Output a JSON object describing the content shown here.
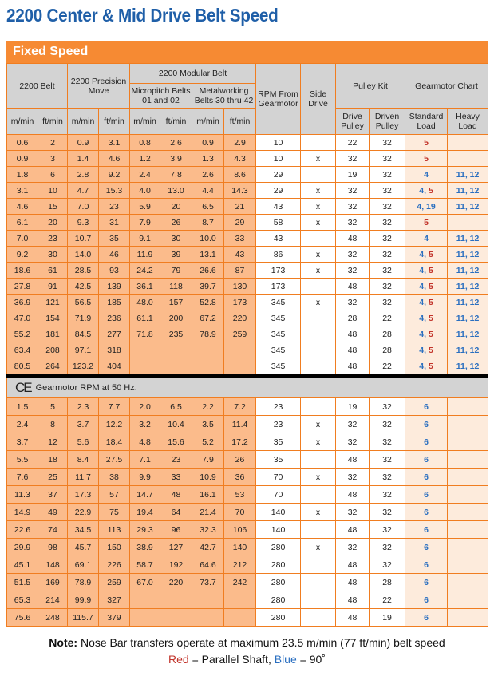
{
  "title": "2200 Center & Mid Drive Belt Speed",
  "section_label": "Fixed Speed",
  "headers": {
    "belt_2200": "2200 Belt",
    "precision_move": "2200 Precision Move",
    "modular_belt": "2200 Modular Belt",
    "micropitch": "Micropitch Belts 01 and 02",
    "metalworking": "Metalworking Belts 30 thru 42",
    "rpm": "RPM From Gearmotor",
    "side_drive": "Side Drive",
    "pulley_kit": "Pulley Kit",
    "gearmotor_chart": "Gearmotor Chart",
    "m_min": "m/min",
    "ft_min": "ft/min",
    "drive_pulley": "Drive Pulley",
    "driven_pulley": "Driven Pulley",
    "standard_load": "Standard Load",
    "heavy_load": "Heavy Load"
  },
  "colors": {
    "red": "#c2342b",
    "blue": "#2a6fc0",
    "accent": "#f68a33"
  },
  "rows_60hz": [
    {
      "v": [
        "0.6",
        "2",
        "0.9",
        "3.1",
        "0.8",
        "2.6",
        "0.9",
        "2.9"
      ],
      "rpm": "10",
      "side": "",
      "drive": "22",
      "driven": "32",
      "std": [
        {
          "t": "5",
          "c": "red"
        }
      ],
      "heavy": ""
    },
    {
      "v": [
        "0.9",
        "3",
        "1.4",
        "4.6",
        "1.2",
        "3.9",
        "1.3",
        "4.3"
      ],
      "rpm": "10",
      "side": "x",
      "drive": "32",
      "driven": "32",
      "std": [
        {
          "t": "5",
          "c": "red"
        }
      ],
      "heavy": ""
    },
    {
      "v": [
        "1.8",
        "6",
        "2.8",
        "9.2",
        "2.4",
        "7.8",
        "2.6",
        "8.6"
      ],
      "rpm": "29",
      "side": "",
      "drive": "19",
      "driven": "32",
      "std": [
        {
          "t": "4",
          "c": "blue"
        }
      ],
      "heavy": "11, 12"
    },
    {
      "v": [
        "3.1",
        "10",
        "4.7",
        "15.3",
        "4.0",
        "13.0",
        "4.4",
        "14.3"
      ],
      "rpm": "29",
      "side": "x",
      "drive": "32",
      "driven": "32",
      "std": [
        {
          "t": "4",
          "c": "blue"
        },
        {
          "t": "5",
          "c": "red"
        }
      ],
      "heavy": "11, 12"
    },
    {
      "v": [
        "4.6",
        "15",
        "7.0",
        "23",
        "5.9",
        "20",
        "6.5",
        "21"
      ],
      "rpm": "43",
      "side": "x",
      "drive": "32",
      "driven": "32",
      "std": [
        {
          "t": "4",
          "c": "blue"
        },
        {
          "t": "19",
          "c": "blue"
        }
      ],
      "heavy": "11, 12"
    },
    {
      "v": [
        "6.1",
        "20",
        "9.3",
        "31",
        "7.9",
        "26",
        "8.7",
        "29"
      ],
      "rpm": "58",
      "side": "x",
      "drive": "32",
      "driven": "32",
      "std": [
        {
          "t": "5",
          "c": "red"
        }
      ],
      "heavy": ""
    },
    {
      "v": [
        "7.0",
        "23",
        "10.7",
        "35",
        "9.1",
        "30",
        "10.0",
        "33"
      ],
      "rpm": "43",
      "side": "",
      "drive": "48",
      "driven": "32",
      "std": [
        {
          "t": "4",
          "c": "blue"
        }
      ],
      "heavy": "11, 12"
    },
    {
      "v": [
        "9.2",
        "30",
        "14.0",
        "46",
        "11.9",
        "39",
        "13.1",
        "43"
      ],
      "rpm": "86",
      "side": "x",
      "drive": "32",
      "driven": "32",
      "std": [
        {
          "t": "4",
          "c": "blue"
        },
        {
          "t": "5",
          "c": "red"
        }
      ],
      "heavy": "11, 12"
    },
    {
      "v": [
        "18.6",
        "61",
        "28.5",
        "93",
        "24.2",
        "79",
        "26.6",
        "87"
      ],
      "rpm": "173",
      "side": "x",
      "drive": "32",
      "driven": "32",
      "std": [
        {
          "t": "4",
          "c": "blue"
        },
        {
          "t": "5",
          "c": "red"
        }
      ],
      "heavy": "11, 12"
    },
    {
      "v": [
        "27.8",
        "91",
        "42.5",
        "139",
        "36.1",
        "118",
        "39.7",
        "130"
      ],
      "rpm": "173",
      "side": "",
      "drive": "48",
      "driven": "32",
      "std": [
        {
          "t": "4",
          "c": "blue"
        },
        {
          "t": "5",
          "c": "red"
        }
      ],
      "heavy": "11, 12"
    },
    {
      "v": [
        "36.9",
        "121",
        "56.5",
        "185",
        "48.0",
        "157",
        "52.8",
        "173"
      ],
      "rpm": "345",
      "side": "x",
      "drive": "32",
      "driven": "32",
      "std": [
        {
          "t": "4",
          "c": "blue"
        },
        {
          "t": "5",
          "c": "red"
        }
      ],
      "heavy": "11, 12"
    },
    {
      "v": [
        "47.0",
        "154",
        "71.9",
        "236",
        "61.1",
        "200",
        "67.2",
        "220"
      ],
      "rpm": "345",
      "side": "",
      "drive": "28",
      "driven": "22",
      "std": [
        {
          "t": "4",
          "c": "blue"
        },
        {
          "t": "5",
          "c": "red"
        }
      ],
      "heavy": "11, 12"
    },
    {
      "v": [
        "55.2",
        "181",
        "84.5",
        "277",
        "71.8",
        "235",
        "78.9",
        "259"
      ],
      "rpm": "345",
      "side": "",
      "drive": "48",
      "driven": "28",
      "std": [
        {
          "t": "4",
          "c": "blue"
        },
        {
          "t": "5",
          "c": "red"
        }
      ],
      "heavy": "11, 12"
    },
    {
      "v": [
        "63.4",
        "208",
        "97.1",
        "318",
        "",
        "",
        "",
        ""
      ],
      "rpm": "345",
      "side": "",
      "drive": "48",
      "driven": "28",
      "std": [
        {
          "t": "4",
          "c": "blue"
        },
        {
          "t": "5",
          "c": "red"
        }
      ],
      "heavy": "11, 12"
    },
    {
      "v": [
        "80.5",
        "264",
        "123.2",
        "404",
        "",
        "",
        "",
        ""
      ],
      "rpm": "345",
      "side": "",
      "drive": "48",
      "driven": "22",
      "std": [
        {
          "t": "4",
          "c": "blue"
        },
        {
          "t": "5",
          "c": "red"
        }
      ],
      "heavy": "11, 12"
    }
  ],
  "ce_section": {
    "mark": "CE",
    "label": "Gearmotor RPM at 50 Hz."
  },
  "rows_50hz": [
    {
      "v": [
        "1.5",
        "5",
        "2.3",
        "7.7",
        "2.0",
        "6.5",
        "2.2",
        "7.2"
      ],
      "rpm": "23",
      "side": "",
      "drive": "19",
      "driven": "32",
      "std": [
        {
          "t": "6",
          "c": "blue"
        }
      ],
      "heavy": ""
    },
    {
      "v": [
        "2.4",
        "8",
        "3.7",
        "12.2",
        "3.2",
        "10.4",
        "3.5",
        "11.4"
      ],
      "rpm": "23",
      "side": "x",
      "drive": "32",
      "driven": "32",
      "std": [
        {
          "t": "6",
          "c": "blue"
        }
      ],
      "heavy": ""
    },
    {
      "v": [
        "3.7",
        "12",
        "5.6",
        "18.4",
        "4.8",
        "15.6",
        "5.2",
        "17.2"
      ],
      "rpm": "35",
      "side": "x",
      "drive": "32",
      "driven": "32",
      "std": [
        {
          "t": "6",
          "c": "blue"
        }
      ],
      "heavy": ""
    },
    {
      "v": [
        "5.5",
        "18",
        "8.4",
        "27.5",
        "7.1",
        "23",
        "7.9",
        "26"
      ],
      "rpm": "35",
      "side": "",
      "drive": "48",
      "driven": "32",
      "std": [
        {
          "t": "6",
          "c": "blue"
        }
      ],
      "heavy": ""
    },
    {
      "v": [
        "7.6",
        "25",
        "11.7",
        "38",
        "9.9",
        "33",
        "10.9",
        "36"
      ],
      "rpm": "70",
      "side": "x",
      "drive": "32",
      "driven": "32",
      "std": [
        {
          "t": "6",
          "c": "blue"
        }
      ],
      "heavy": ""
    },
    {
      "v": [
        "11.3",
        "37",
        "17.3",
        "57",
        "14.7",
        "48",
        "16.1",
        "53"
      ],
      "rpm": "70",
      "side": "",
      "drive": "48",
      "driven": "32",
      "std": [
        {
          "t": "6",
          "c": "blue"
        }
      ],
      "heavy": ""
    },
    {
      "v": [
        "14.9",
        "49",
        "22.9",
        "75",
        "19.4",
        "64",
        "21.4",
        "70"
      ],
      "rpm": "140",
      "side": "x",
      "drive": "32",
      "driven": "32",
      "std": [
        {
          "t": "6",
          "c": "blue"
        }
      ],
      "heavy": ""
    },
    {
      "v": [
        "22.6",
        "74",
        "34.5",
        "113",
        "29.3",
        "96",
        "32.3",
        "106"
      ],
      "rpm": "140",
      "side": "",
      "drive": "48",
      "driven": "32",
      "std": [
        {
          "t": "6",
          "c": "blue"
        }
      ],
      "heavy": ""
    },
    {
      "v": [
        "29.9",
        "98",
        "45.7",
        "150",
        "38.9",
        "127",
        "42.7",
        "140"
      ],
      "rpm": "280",
      "side": "x",
      "drive": "32",
      "driven": "32",
      "std": [
        {
          "t": "6",
          "c": "blue"
        }
      ],
      "heavy": ""
    },
    {
      "v": [
        "45.1",
        "148",
        "69.1",
        "226",
        "58.7",
        "192",
        "64.6",
        "212"
      ],
      "rpm": "280",
      "side": "",
      "drive": "48",
      "driven": "32",
      "std": [
        {
          "t": "6",
          "c": "blue"
        }
      ],
      "heavy": ""
    },
    {
      "v": [
        "51.5",
        "169",
        "78.9",
        "259",
        "67.0",
        "220",
        "73.7",
        "242"
      ],
      "rpm": "280",
      "side": "",
      "drive": "48",
      "driven": "28",
      "std": [
        {
          "t": "6",
          "c": "blue"
        }
      ],
      "heavy": ""
    },
    {
      "v": [
        "65.3",
        "214",
        "99.9",
        "327",
        "",
        "",
        "",
        ""
      ],
      "rpm": "280",
      "side": "",
      "drive": "48",
      "driven": "22",
      "std": [
        {
          "t": "6",
          "c": "blue"
        }
      ],
      "heavy": ""
    },
    {
      "v": [
        "75.6",
        "248",
        "115.7",
        "379",
        "",
        "",
        "",
        ""
      ],
      "rpm": "280",
      "side": "",
      "drive": "48",
      "driven": "19",
      "std": [
        {
          "t": "6",
          "c": "blue"
        }
      ],
      "heavy": ""
    }
  ],
  "note": {
    "label": "Note:",
    "text": " Nose Bar transfers operate at maximum 23.5 m/min (77 ft/min) belt speed"
  },
  "legend": {
    "red_word": "Red",
    "red_meaning": " = Parallel Shaft, ",
    "blue_word": "Blue",
    "blue_meaning": " = 90˚"
  }
}
